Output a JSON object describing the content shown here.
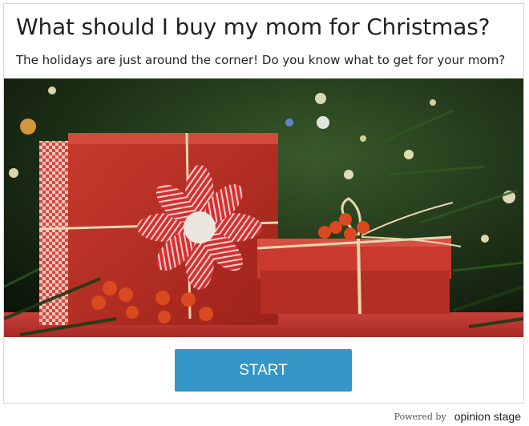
{
  "quiz": {
    "title": "What should I buy my mom for Christmas?",
    "subtitle": "The holidays are just around the corner! Do you know what to get for your mom?",
    "start_label": "START"
  },
  "hero_image": {
    "subject": "two red wrapped gift boxes with twine and holly berries in front of a Christmas tree"
  },
  "footer": {
    "powered_by": "Powered by",
    "brand": "opinion stage"
  },
  "colors": {
    "accent": "#3496c6",
    "text": "#222222",
    "border": "#d6d6d6"
  }
}
